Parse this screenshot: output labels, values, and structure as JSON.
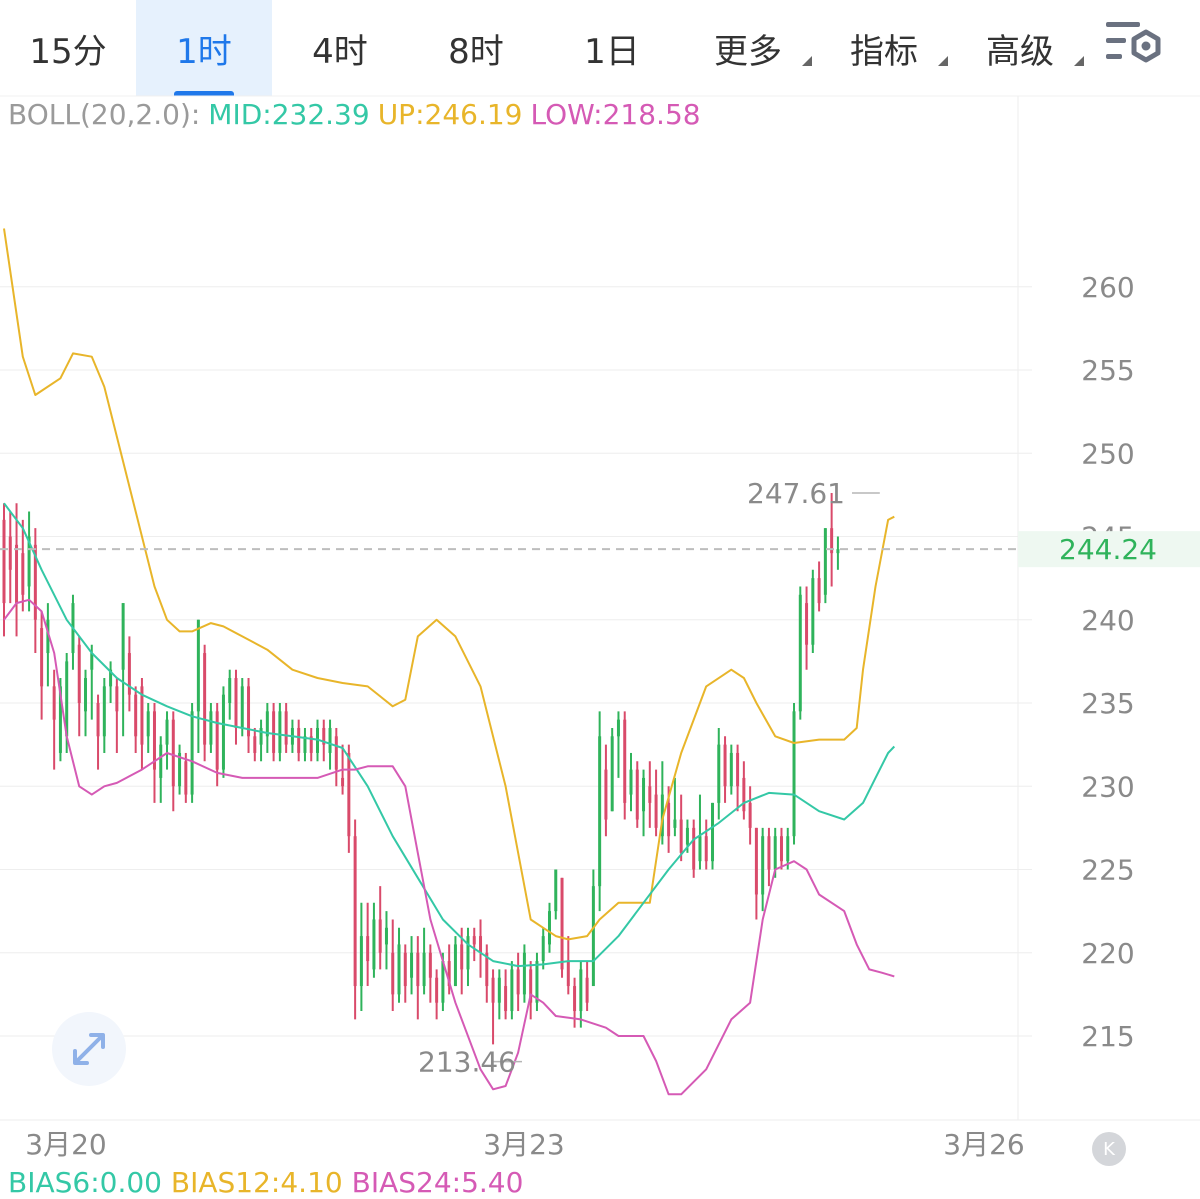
{
  "tabs": [
    {
      "label": "15分",
      "active": false,
      "dropdown": false
    },
    {
      "label": "1时",
      "active": true,
      "dropdown": false
    },
    {
      "label": "4时",
      "active": false,
      "dropdown": false
    },
    {
      "label": "8时",
      "active": false,
      "dropdown": false
    },
    {
      "label": "1日",
      "active": false,
      "dropdown": false
    },
    {
      "label": "更多",
      "active": false,
      "dropdown": true
    },
    {
      "label": "指标",
      "active": false,
      "dropdown": true
    },
    {
      "label": "高级",
      "active": false,
      "dropdown": true
    }
  ],
  "settings_icon": "chart-settings-icon",
  "indicator": {
    "name": "BOLL(20,2.0):",
    "mid": "MID:232.39",
    "up": "UP:246.19",
    "low": "LOW:218.58"
  },
  "bias": {
    "b6": "BIAS6:0.00",
    "b12": "BIAS12:4.10",
    "b24": "BIAS24:5.40"
  },
  "colors": {
    "up": "#2fb35b",
    "down": "#d94a6a",
    "mid": "#34c8a6",
    "upper": "#e8b52a",
    "lower": "#d55ab5",
    "grid": "#eeeeee",
    "axis_text": "#8a8a8a",
    "accent": "#1f78ea",
    "price_tag_bg": "#eef8f1",
    "price_tag_text": "#2fb35b"
  },
  "chart_data": {
    "type": "candlestick",
    "y_ticks": [
      215,
      220,
      225,
      230,
      235,
      240,
      245,
      250,
      255,
      260
    ],
    "x_ticks": [
      "3月20",
      "3月23",
      "3月26"
    ],
    "current_price": "244.24",
    "max_label": "247.61",
    "min_label": "213.46",
    "candles": [
      [
        246.0,
        241.0,
        239.0,
        247.0
      ],
      [
        245.0,
        243.0,
        241.0,
        246.5
      ],
      [
        244.5,
        241.0,
        239.0,
        247.0
      ],
      [
        244.0,
        241.5,
        240.5,
        246.0
      ],
      [
        242.0,
        245.0,
        240.5,
        246.5
      ],
      [
        244.5,
        240.0,
        238.0,
        245.5
      ],
      [
        239.5,
        236.0,
        234.0,
        240.5
      ],
      [
        238.0,
        240.0,
        236.0,
        241.0
      ],
      [
        236.0,
        234.0,
        231.0,
        237.0
      ],
      [
        232.0,
        236.0,
        231.5,
        236.5
      ],
      [
        233.0,
        237.5,
        232.0,
        238.0
      ],
      [
        238.0,
        241.0,
        237.0,
        241.5
      ],
      [
        238.5,
        235.0,
        233.0,
        239.0
      ],
      [
        234.5,
        236.5,
        233.0,
        237.0
      ],
      [
        237.0,
        238.0,
        234.0,
        238.5
      ],
      [
        235.0,
        233.0,
        231.0,
        235.5
      ],
      [
        233.0,
        236.0,
        232.0,
        236.5
      ],
      [
        236.0,
        237.0,
        235.0,
        237.5
      ],
      [
        236.0,
        234.5,
        232.0,
        236.5
      ],
      [
        237.0,
        241.0,
        233.0,
        241.0
      ],
      [
        238.0,
        235.5,
        234.5,
        239.0
      ],
      [
        235.5,
        233.0,
        232.0,
        236.0
      ],
      [
        236.0,
        232.5,
        231.0,
        236.5
      ],
      [
        233.0,
        234.5,
        232.0,
        235.0
      ],
      [
        234.5,
        231.0,
        229.0,
        235.0
      ],
      [
        230.5,
        232.5,
        229.0,
        233.0
      ],
      [
        232.5,
        234.0,
        231.0,
        234.5
      ],
      [
        234.0,
        230.0,
        228.5,
        234.5
      ],
      [
        230.0,
        232.0,
        229.5,
        232.5
      ],
      [
        231.5,
        229.5,
        229.0,
        232.0
      ],
      [
        229.5,
        234.5,
        229.0,
        235.0
      ],
      [
        234.5,
        240.0,
        232.0,
        240.0
      ],
      [
        238.0,
        232.5,
        231.5,
        238.5
      ],
      [
        232.5,
        234.5,
        232.0,
        235.0
      ],
      [
        234.5,
        231.0,
        230.0,
        235.0
      ],
      [
        231.0,
        235.5,
        230.5,
        236.0
      ],
      [
        235.0,
        236.5,
        234.0,
        237.0
      ],
      [
        236.5,
        233.5,
        232.5,
        237.0
      ],
      [
        233.5,
        236.0,
        233.0,
        236.5
      ],
      [
        236.0,
        233.0,
        232.0,
        236.5
      ],
      [
        233.0,
        232.0,
        231.5,
        233.5
      ],
      [
        232.5,
        233.5,
        231.5,
        234.0
      ],
      [
        233.0,
        234.5,
        232.0,
        235.0
      ],
      [
        234.5,
        232.0,
        231.5,
        235.0
      ],
      [
        232.0,
        234.5,
        231.5,
        235.0
      ],
      [
        234.5,
        232.5,
        232.0,
        235.0
      ],
      [
        232.5,
        233.5,
        232.0,
        234.0
      ],
      [
        233.5,
        232.0,
        231.5,
        234.0
      ],
      [
        232.0,
        233.0,
        231.5,
        233.5
      ],
      [
        233.0,
        232.0,
        231.5,
        233.5
      ],
      [
        232.0,
        233.5,
        231.5,
        234.0
      ],
      [
        233.5,
        232.5,
        231.5,
        234.0
      ],
      [
        232.0,
        233.5,
        231.0,
        234.0
      ],
      [
        233.0,
        231.0,
        230.0,
        233.5
      ],
      [
        230.5,
        230.0,
        229.5,
        232.5
      ],
      [
        232.0,
        227.0,
        226.0,
        232.5
      ],
      [
        227.0,
        218.0,
        216.0,
        228.0
      ],
      [
        218.0,
        221.0,
        216.5,
        223.0
      ],
      [
        221.0,
        219.5,
        218.0,
        223.0
      ],
      [
        219.0,
        222.0,
        218.5,
        223.0
      ],
      [
        222.0,
        220.0,
        219.0,
        224.0
      ],
      [
        220.5,
        221.5,
        219.0,
        222.5
      ],
      [
        220.0,
        217.5,
        216.5,
        222.0
      ],
      [
        217.5,
        220.5,
        217.0,
        221.5
      ],
      [
        220.0,
        218.0,
        217.0,
        220.5
      ],
      [
        218.5,
        220.0,
        217.5,
        221.0
      ],
      [
        220.0,
        218.0,
        216.0,
        221.0
      ],
      [
        218.0,
        220.0,
        217.5,
        221.5
      ],
      [
        220.0,
        218.5,
        217.0,
        220.5
      ],
      [
        218.5,
        217.0,
        216.0,
        219.0
      ],
      [
        217.0,
        219.5,
        216.5,
        220.0
      ],
      [
        219.5,
        218.0,
        217.5,
        220.5
      ],
      [
        218.0,
        220.5,
        218.0,
        221.0
      ],
      [
        220.5,
        219.0,
        217.5,
        221.5
      ],
      [
        219.0,
        221.0,
        218.0,
        221.5
      ],
      [
        221.0,
        220.5,
        219.5,
        221.5
      ],
      [
        221.0,
        220.0,
        218.5,
        222.0
      ],
      [
        220.0,
        218.0,
        217.0,
        220.5
      ],
      [
        218.5,
        217.0,
        214.5,
        219.0
      ],
      [
        217.0,
        218.5,
        216.0,
        219.0
      ],
      [
        218.0,
        216.5,
        216.0,
        219.0
      ],
      [
        216.5,
        219.0,
        216.0,
        219.5
      ],
      [
        219.0,
        217.5,
        216.5,
        220.0
      ],
      [
        217.5,
        220.0,
        217.0,
        220.5
      ],
      [
        219.0,
        217.0,
        216.0,
        219.5
      ],
      [
        217.0,
        219.5,
        216.5,
        220.0
      ],
      [
        219.5,
        221.0,
        219.0,
        221.5
      ],
      [
        220.5,
        222.5,
        220.0,
        223.0
      ],
      [
        222.5,
        225.0,
        222.0,
        225.0
      ],
      [
        224.5,
        219.0,
        218.5,
        224.5
      ],
      [
        219.5,
        218.0,
        217.5,
        221.0
      ],
      [
        218.0,
        216.5,
        215.5,
        218.5
      ],
      [
        216.5,
        219.0,
        215.5,
        219.5
      ],
      [
        218.5,
        217.0,
        216.5,
        219.5
      ],
      [
        218.0,
        224.0,
        218.0,
        225.0
      ],
      [
        224.0,
        233.0,
        222.5,
        234.5
      ],
      [
        231.0,
        228.0,
        227.0,
        232.5
      ],
      [
        228.5,
        233.0,
        228.5,
        233.5
      ],
      [
        233.0,
        234.0,
        230.5,
        234.5
      ],
      [
        234.0,
        229.0,
        228.0,
        234.5
      ],
      [
        229.5,
        231.0,
        228.5,
        232.0
      ],
      [
        231.0,
        228.0,
        227.5,
        231.5
      ],
      [
        228.5,
        230.5,
        227.0,
        231.0
      ],
      [
        230.0,
        229.0,
        227.5,
        231.5
      ],
      [
        229.5,
        227.5,
        227.0,
        231.0
      ],
      [
        227.0,
        229.5,
        226.5,
        231.5
      ],
      [
        229.0,
        227.0,
        226.0,
        230.0
      ],
      [
        227.5,
        228.0,
        227.0,
        230.5
      ],
      [
        228.0,
        226.0,
        225.5,
        229.5
      ],
      [
        226.5,
        227.5,
        226.0,
        228.0
      ],
      [
        227.5,
        225.0,
        224.5,
        228.0
      ],
      [
        225.5,
        227.0,
        225.0,
        229.5
      ],
      [
        227.0,
        225.5,
        225.0,
        228.0
      ],
      [
        225.5,
        229.0,
        225.0,
        229.0
      ],
      [
        229.0,
        232.5,
        228.0,
        233.5
      ],
      [
        232.5,
        230.0,
        229.0,
        233.0
      ],
      [
        230.0,
        232.0,
        229.5,
        232.5
      ],
      [
        232.0,
        230.0,
        228.5,
        232.5
      ],
      [
        230.5,
        228.5,
        228.0,
        231.5
      ],
      [
        229.0,
        227.5,
        226.5,
        230.0
      ],
      [
        227.5,
        223.5,
        222.0,
        227.5
      ],
      [
        223.5,
        227.0,
        222.5,
        227.5
      ],
      [
        227.0,
        225.0,
        224.0,
        227.5
      ],
      [
        225.0,
        227.0,
        224.5,
        227.5
      ],
      [
        227.0,
        225.5,
        225.0,
        227.5
      ],
      [
        225.5,
        227.0,
        225.0,
        227.5
      ],
      [
        227.0,
        234.5,
        226.5,
        235.0
      ],
      [
        234.5,
        241.5,
        234.0,
        242.0
      ],
      [
        241.0,
        238.5,
        237.0,
        242.0
      ],
      [
        238.5,
        242.5,
        238.0,
        243.0
      ],
      [
        242.5,
        241.0,
        240.5,
        243.5
      ],
      [
        241.5,
        245.5,
        241.0,
        245.5
      ],
      [
        245.5,
        244.0,
        242.0,
        247.61
      ],
      [
        244.0,
        244.24,
        243.0,
        245.0
      ]
    ],
    "mid": [
      [
        0,
        247.0
      ],
      [
        3,
        245.5
      ],
      [
        6,
        243.0
      ],
      [
        10,
        240.0
      ],
      [
        14,
        238.0
      ],
      [
        18,
        236.5
      ],
      [
        22,
        235.5
      ],
      [
        26,
        234.8
      ],
      [
        30,
        234.2
      ],
      [
        34,
        233.8
      ],
      [
        38,
        233.5
      ],
      [
        42,
        233.2
      ],
      [
        46,
        233.0
      ],
      [
        50,
        232.8
      ],
      [
        54,
        232.3
      ],
      [
        58,
        230.0
      ],
      [
        62,
        227.0
      ],
      [
        66,
        224.5
      ],
      [
        70,
        222.0
      ],
      [
        74,
        220.5
      ],
      [
        78,
        219.5
      ],
      [
        82,
        219.2
      ],
      [
        86,
        219.3
      ],
      [
        90,
        219.5
      ],
      [
        94,
        219.5
      ],
      [
        98,
        221.0
      ],
      [
        102,
        223.0
      ],
      [
        106,
        225.0
      ],
      [
        110,
        226.8
      ],
      [
        114,
        227.8
      ],
      [
        118,
        229.0
      ],
      [
        122,
        229.6
      ],
      [
        126,
        229.5
      ],
      [
        130,
        228.5
      ],
      [
        134,
        228.0
      ],
      [
        137,
        229.0
      ],
      [
        139,
        230.5
      ],
      [
        141,
        232.0
      ],
      [
        142,
        232.39
      ]
    ],
    "upper": [
      [
        0,
        263.5
      ],
      [
        3,
        255.8
      ],
      [
        5,
        253.5
      ],
      [
        9,
        254.5
      ],
      [
        11,
        256.0
      ],
      [
        14,
        255.8
      ],
      [
        16,
        254.0
      ],
      [
        20,
        248.0
      ],
      [
        24,
        242.0
      ],
      [
        26,
        240.0
      ],
      [
        28,
        239.3
      ],
      [
        30,
        239.3
      ],
      [
        33,
        239.8
      ],
      [
        35,
        239.6
      ],
      [
        38,
        239.0
      ],
      [
        42,
        238.2
      ],
      [
        46,
        237.0
      ],
      [
        50,
        236.5
      ],
      [
        54,
        236.2
      ],
      [
        58,
        236.0
      ],
      [
        62,
        234.8
      ],
      [
        64,
        235.2
      ],
      [
        66,
        239.0
      ],
      [
        69,
        240.0
      ],
      [
        72,
        239.0
      ],
      [
        76,
        236.0
      ],
      [
        80,
        230.0
      ],
      [
        84,
        222.0
      ],
      [
        86,
        221.5
      ],
      [
        88,
        221.0
      ],
      [
        90,
        220.8
      ],
      [
        93,
        221.0
      ],
      [
        95,
        222.0
      ],
      [
        98,
        223.0
      ],
      [
        101,
        223.0
      ],
      [
        103,
        223.0
      ],
      [
        105,
        228.0
      ],
      [
        108,
        232.0
      ],
      [
        112,
        236.0
      ],
      [
        116,
        237.0
      ],
      [
        118,
        236.5
      ],
      [
        120,
        235.0
      ],
      [
        123,
        233.0
      ],
      [
        126,
        232.6
      ],
      [
        130,
        232.8
      ],
      [
        134,
        232.8
      ],
      [
        136,
        233.5
      ],
      [
        137,
        237.0
      ],
      [
        139,
        242.0
      ],
      [
        141,
        246.0
      ],
      [
        142,
        246.19
      ]
    ],
    "lower": [
      [
        0,
        240.0
      ],
      [
        2,
        241.0
      ],
      [
        4,
        241.2
      ],
      [
        6,
        240.5
      ],
      [
        8,
        238.0
      ],
      [
        10,
        233.0
      ],
      [
        12,
        230.0
      ],
      [
        14,
        229.5
      ],
      [
        16,
        230.0
      ],
      [
        18,
        230.2
      ],
      [
        22,
        231.0
      ],
      [
        26,
        232.0
      ],
      [
        30,
        231.5
      ],
      [
        34,
        230.8
      ],
      [
        38,
        230.5
      ],
      [
        44,
        230.5
      ],
      [
        50,
        230.5
      ],
      [
        54,
        231.0
      ],
      [
        56,
        231.0
      ],
      [
        58,
        231.2
      ],
      [
        62,
        231.2
      ],
      [
        64,
        230.0
      ],
      [
        66,
        226.0
      ],
      [
        68,
        222.0
      ],
      [
        72,
        217.0
      ],
      [
        76,
        213.0
      ],
      [
        78,
        211.8
      ],
      [
        80,
        212.0
      ],
      [
        82,
        214.0
      ],
      [
        84,
        217.5
      ],
      [
        86,
        217.0
      ],
      [
        88,
        216.2
      ],
      [
        92,
        216.0
      ],
      [
        96,
        215.5
      ],
      [
        98,
        215.0
      ],
      [
        102,
        215.0
      ],
      [
        104,
        213.5
      ],
      [
        106,
        211.5
      ],
      [
        108,
        211.5
      ],
      [
        112,
        213.0
      ],
      [
        116,
        216.0
      ],
      [
        119,
        217.0
      ],
      [
        121,
        222.0
      ],
      [
        123,
        225.0
      ],
      [
        126,
        225.5
      ],
      [
        128,
        225.0
      ],
      [
        130,
        223.5
      ],
      [
        134,
        222.5
      ],
      [
        136,
        220.5
      ],
      [
        138,
        219.0
      ],
      [
        140,
        218.8
      ],
      [
        142,
        218.58
      ]
    ]
  }
}
